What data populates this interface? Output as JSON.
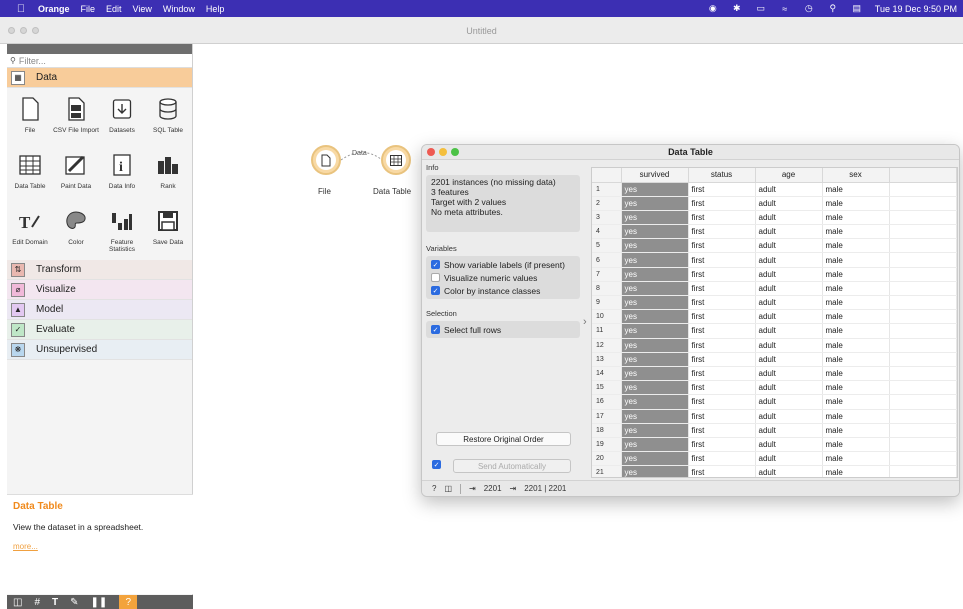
{
  "menubar": {
    "app_name": "Orange",
    "items": [
      "File",
      "Edit",
      "View",
      "Window",
      "Help"
    ],
    "clock": "Tue 19 Dec  9:50 PM"
  },
  "window": {
    "title": "Untitled"
  },
  "left_panel": {
    "filter_placeholder": "Filter...",
    "active_category": "Data",
    "widgets": [
      {
        "label": "File",
        "icon": "file-icon"
      },
      {
        "label": "CSV File Import",
        "icon": "csv-icon"
      },
      {
        "label": "Datasets",
        "icon": "datasets-icon"
      },
      {
        "label": "SQL Table",
        "icon": "sql-table-icon"
      },
      {
        "label": "Data Table",
        "icon": "data-table-icon"
      },
      {
        "label": "Paint Data",
        "icon": "paint-data-icon"
      },
      {
        "label": "Data Info",
        "icon": "data-info-icon"
      },
      {
        "label": "Rank",
        "icon": "rank-icon"
      },
      {
        "label": "Edit Domain",
        "icon": "edit-domain-icon"
      },
      {
        "label": "Color",
        "icon": "color-icon"
      },
      {
        "label": "Feature Statistics",
        "icon": "feature-statistics-icon"
      },
      {
        "label": "Save Data",
        "icon": "save-data-icon"
      }
    ],
    "categories": [
      "Transform",
      "Visualize",
      "Model",
      "Evaluate",
      "Unsupervised"
    ],
    "description": {
      "title": "Data Table",
      "text": "View the dataset in a spreadsheet.",
      "more": "more..."
    }
  },
  "canvas": {
    "nodes": [
      {
        "label": "File"
      },
      {
        "label": "Data Table"
      }
    ],
    "link_label": "Data"
  },
  "data_table_window": {
    "title": "Data Table",
    "info_label": "Info",
    "info_lines": [
      "2201 instances (no missing data)",
      "3 features",
      "Target with 2 values",
      "No meta attributes."
    ],
    "variables_label": "Variables",
    "variables": [
      {
        "label": "Show variable labels (if present)",
        "checked": true
      },
      {
        "label": "Visualize numeric values",
        "checked": false
      },
      {
        "label": "Color by instance classes",
        "checked": true
      }
    ],
    "selection_label": "Selection",
    "selection": {
      "label": "Select full rows",
      "checked": true
    },
    "restore_button": "Restore Original Order",
    "send_button": "Send Automatically",
    "send_checked": true,
    "columns": [
      "survived",
      "status",
      "age",
      "sex"
    ],
    "rows": [
      [
        "1",
        "yes",
        "first",
        "adult",
        "male"
      ],
      [
        "2",
        "yes",
        "first",
        "adult",
        "male"
      ],
      [
        "3",
        "yes",
        "first",
        "adult",
        "male"
      ],
      [
        "4",
        "yes",
        "first",
        "adult",
        "male"
      ],
      [
        "5",
        "yes",
        "first",
        "adult",
        "male"
      ],
      [
        "6",
        "yes",
        "first",
        "adult",
        "male"
      ],
      [
        "7",
        "yes",
        "first",
        "adult",
        "male"
      ],
      [
        "8",
        "yes",
        "first",
        "adult",
        "male"
      ],
      [
        "9",
        "yes",
        "first",
        "adult",
        "male"
      ],
      [
        "10",
        "yes",
        "first",
        "adult",
        "male"
      ],
      [
        "11",
        "yes",
        "first",
        "adult",
        "male"
      ],
      [
        "12",
        "yes",
        "first",
        "adult",
        "male"
      ],
      [
        "13",
        "yes",
        "first",
        "adult",
        "male"
      ],
      [
        "14",
        "yes",
        "first",
        "adult",
        "male"
      ],
      [
        "15",
        "yes",
        "first",
        "adult",
        "male"
      ],
      [
        "16",
        "yes",
        "first",
        "adult",
        "male"
      ],
      [
        "17",
        "yes",
        "first",
        "adult",
        "male"
      ],
      [
        "18",
        "yes",
        "first",
        "adult",
        "male"
      ],
      [
        "19",
        "yes",
        "first",
        "adult",
        "male"
      ],
      [
        "20",
        "yes",
        "first",
        "adult",
        "male"
      ],
      [
        "21",
        "yes",
        "first",
        "adult",
        "male"
      ]
    ],
    "status": {
      "input": "2201",
      "output": "2201 | 2201"
    }
  }
}
